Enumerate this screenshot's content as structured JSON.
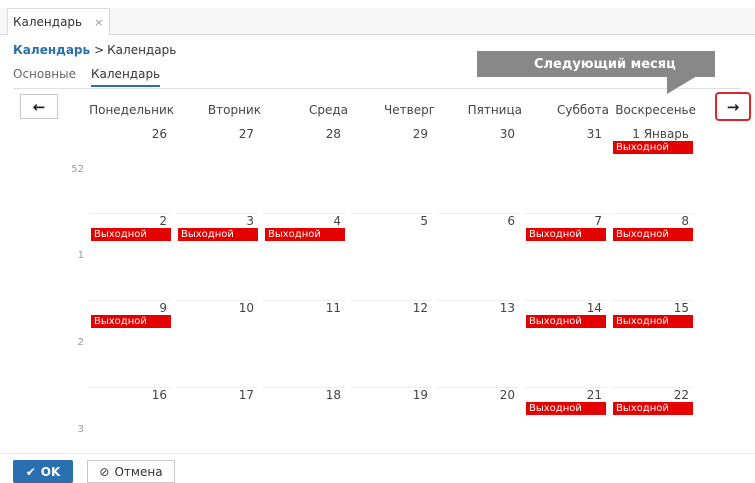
{
  "window_tab": {
    "label": "Календарь",
    "close_icon": "×"
  },
  "breadcrumb": {
    "link": "Календарь",
    "separator": ">",
    "current": "Календарь"
  },
  "subtabs": [
    {
      "label": "Основные",
      "active": false
    },
    {
      "label": "Календарь",
      "active": true
    }
  ],
  "tooltip": {
    "text": "Следующий месяц"
  },
  "nav": {
    "prev_icon": "←",
    "next_icon": "→"
  },
  "weekdays": [
    "Понедельник",
    "Вторник",
    "Среда",
    "Четверг",
    "Пятница",
    "Суббота",
    "Воскресенье"
  ],
  "holiday_label": "Выходной",
  "weeks": [
    {
      "number": "52",
      "days": [
        {
          "label": "26",
          "holiday": false
        },
        {
          "label": "27",
          "holiday": false
        },
        {
          "label": "28",
          "holiday": false
        },
        {
          "label": "29",
          "holiday": false
        },
        {
          "label": "30",
          "holiday": false
        },
        {
          "label": "31",
          "holiday": false
        },
        {
          "label": "1 Январь",
          "holiday": true
        }
      ]
    },
    {
      "number": "1",
      "days": [
        {
          "label": "2",
          "holiday": true
        },
        {
          "label": "3",
          "holiday": true
        },
        {
          "label": "4",
          "holiday": true
        },
        {
          "label": "5",
          "holiday": false
        },
        {
          "label": "6",
          "holiday": false
        },
        {
          "label": "7",
          "holiday": true
        },
        {
          "label": "8",
          "holiday": true
        }
      ]
    },
    {
      "number": "2",
      "days": [
        {
          "label": "9",
          "holiday": true
        },
        {
          "label": "10",
          "holiday": false
        },
        {
          "label": "11",
          "holiday": false
        },
        {
          "label": "12",
          "holiday": false
        },
        {
          "label": "13",
          "holiday": false
        },
        {
          "label": "14",
          "holiday": true
        },
        {
          "label": "15",
          "holiday": true
        }
      ]
    },
    {
      "number": "3",
      "days": [
        {
          "label": "16",
          "holiday": false
        },
        {
          "label": "17",
          "holiday": false
        },
        {
          "label": "18",
          "holiday": false
        },
        {
          "label": "19",
          "holiday": false
        },
        {
          "label": "20",
          "holiday": false
        },
        {
          "label": "21",
          "holiday": true
        },
        {
          "label": "22",
          "holiday": true
        }
      ]
    }
  ],
  "footer": {
    "ok_label": "OK",
    "ok_icon": "✔",
    "cancel_label": "Отмена",
    "cancel_icon": "⊘"
  },
  "colors": {
    "accent": "#2a6fb0",
    "holiday": "#e50000",
    "highlight": "#d9262b",
    "tooltip": "#888888"
  }
}
